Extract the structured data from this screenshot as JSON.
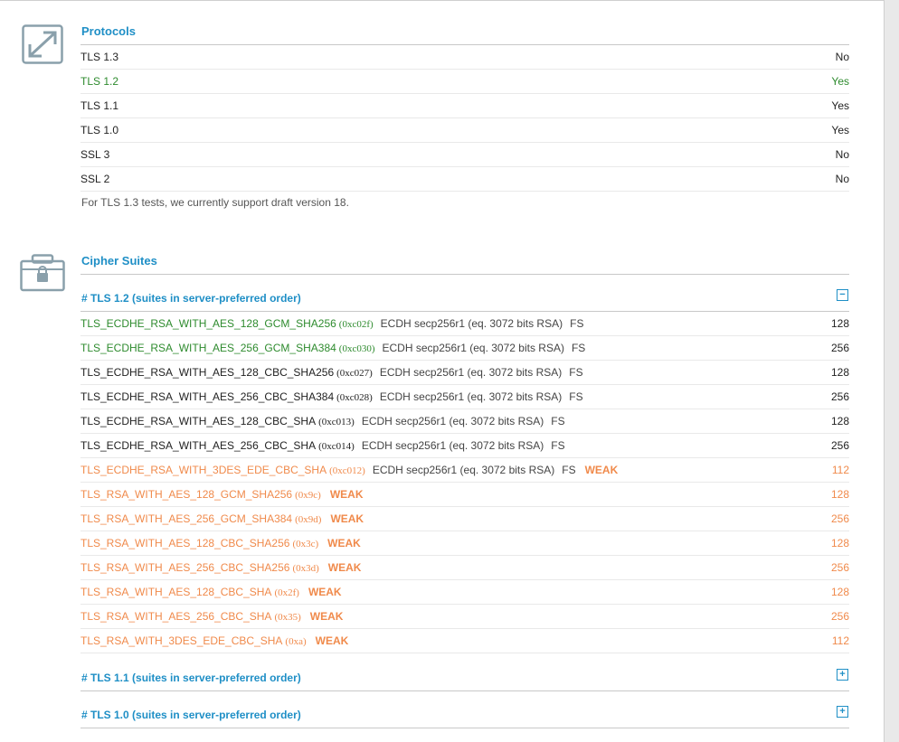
{
  "protocols": {
    "title": "Protocols",
    "rows": [
      {
        "name": "TLS 1.3",
        "value": "No",
        "color": "black"
      },
      {
        "name": "TLS 1.2",
        "value": "Yes",
        "color": "green"
      },
      {
        "name": "TLS 1.1",
        "value": "Yes",
        "color": "black"
      },
      {
        "name": "TLS 1.0",
        "value": "Yes",
        "color": "black"
      },
      {
        "name": "SSL 3",
        "value": "No",
        "color": "black"
      },
      {
        "name": "SSL 2",
        "value": "No",
        "color": "black"
      }
    ],
    "note": "For TLS 1.3 tests, we currently support draft version 18."
  },
  "ciphers": {
    "title": "Cipher Suites",
    "groups": [
      {
        "label": "# TLS 1.2 (suites in server-preferred order)",
        "toggle": "−"
      },
      {
        "label": "# TLS 1.1 (suites in server-preferred order)",
        "toggle": "+"
      },
      {
        "label": "# TLS 1.0 (suites in server-preferred order)",
        "toggle": "+"
      }
    ],
    "suites": [
      {
        "name": "TLS_ECDHE_RSA_WITH_AES_128_GCM_SHA256",
        "code": "(0xc02f)",
        "kex": "ECDH secp256r1 (eq. 3072 bits RSA)",
        "fs": "FS",
        "weak": "",
        "bits": "128",
        "color": "green"
      },
      {
        "name": "TLS_ECDHE_RSA_WITH_AES_256_GCM_SHA384",
        "code": "(0xc030)",
        "kex": "ECDH secp256r1 (eq. 3072 bits RSA)",
        "fs": "FS",
        "weak": "",
        "bits": "256",
        "color": "green"
      },
      {
        "name": "TLS_ECDHE_RSA_WITH_AES_128_CBC_SHA256",
        "code": "(0xc027)",
        "kex": "ECDH secp256r1 (eq. 3072 bits RSA)",
        "fs": "FS",
        "weak": "",
        "bits": "128",
        "color": "black"
      },
      {
        "name": "TLS_ECDHE_RSA_WITH_AES_256_CBC_SHA384",
        "code": "(0xc028)",
        "kex": "ECDH secp256r1 (eq. 3072 bits RSA)",
        "fs": "FS",
        "weak": "",
        "bits": "256",
        "color": "black"
      },
      {
        "name": "TLS_ECDHE_RSA_WITH_AES_128_CBC_SHA",
        "code": "(0xc013)",
        "kex": "ECDH secp256r1 (eq. 3072 bits RSA)",
        "fs": "FS",
        "weak": "",
        "bits": "128",
        "color": "black"
      },
      {
        "name": "TLS_ECDHE_RSA_WITH_AES_256_CBC_SHA",
        "code": "(0xc014)",
        "kex": "ECDH secp256r1 (eq. 3072 bits RSA)",
        "fs": "FS",
        "weak": "",
        "bits": "256",
        "color": "black"
      },
      {
        "name": "TLS_ECDHE_RSA_WITH_3DES_EDE_CBC_SHA",
        "code": "(0xc012)",
        "kex": "ECDH secp256r1 (eq. 3072 bits RSA)",
        "fs": "FS",
        "weak": "WEAK",
        "bits": "112",
        "color": "orange"
      },
      {
        "name": "TLS_RSA_WITH_AES_128_GCM_SHA256",
        "code": "(0x9c)",
        "kex": "",
        "fs": "",
        "weak": "WEAK",
        "bits": "128",
        "color": "orange"
      },
      {
        "name": "TLS_RSA_WITH_AES_256_GCM_SHA384",
        "code": "(0x9d)",
        "kex": "",
        "fs": "",
        "weak": "WEAK",
        "bits": "256",
        "color": "orange"
      },
      {
        "name": "TLS_RSA_WITH_AES_128_CBC_SHA256",
        "code": "(0x3c)",
        "kex": "",
        "fs": "",
        "weak": "WEAK",
        "bits": "128",
        "color": "orange"
      },
      {
        "name": "TLS_RSA_WITH_AES_256_CBC_SHA256",
        "code": "(0x3d)",
        "kex": "",
        "fs": "",
        "weak": "WEAK",
        "bits": "256",
        "color": "orange"
      },
      {
        "name": "TLS_RSA_WITH_AES_128_CBC_SHA",
        "code": "(0x2f)",
        "kex": "",
        "fs": "",
        "weak": "WEAK",
        "bits": "128",
        "color": "orange"
      },
      {
        "name": "TLS_RSA_WITH_AES_256_CBC_SHA",
        "code": "(0x35)",
        "kex": "",
        "fs": "",
        "weak": "WEAK",
        "bits": "256",
        "color": "orange"
      },
      {
        "name": "TLS_RSA_WITH_3DES_EDE_CBC_SHA",
        "code": "(0xa)",
        "kex": "",
        "fs": "",
        "weak": "WEAK",
        "bits": "112",
        "color": "orange"
      }
    ]
  },
  "icons": {
    "protocols": "resize-arrows-icon",
    "ciphers": "locked-briefcase-icon"
  },
  "colors": {
    "accent": "#1f8fc6",
    "ok": "#2e8b2e",
    "weak": "#f08a4b"
  }
}
